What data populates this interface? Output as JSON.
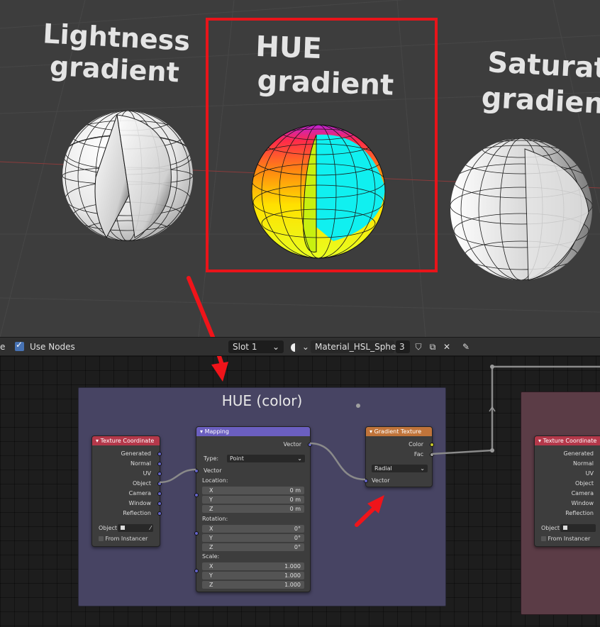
{
  "viewport": {
    "labels": {
      "lightness_line1": "Lightness",
      "lightness_line2": "gradient",
      "hue_line1": "HUE",
      "hue_line2": "gradient",
      "saturation_line1": "Saturat",
      "saturation_line2": "gradient"
    },
    "colors": {
      "highlight_box": "#e8141a",
      "arrow": "#f0141a",
      "background": "#3d3d3d"
    }
  },
  "header": {
    "left_clipped": "e",
    "use_nodes_label": "Use Nodes",
    "use_nodes_checked": true,
    "slot_value": "Slot 1",
    "material_name": "Material_HSL_Sphere",
    "user_count": "3"
  },
  "frames": {
    "hue": {
      "label": "HUE (color)",
      "color": "#474463"
    },
    "right": {
      "label": "",
      "color": "#5b3c46"
    }
  },
  "nodes": {
    "texcoord": {
      "title": "Texture Coordinate",
      "outputs": [
        "Generated",
        "Normal",
        "UV",
        "Object",
        "Camera",
        "Window",
        "Reflection"
      ],
      "object_label": "Object",
      "from_instancer": "From Instancer"
    },
    "texcoord2": {
      "title": "Texture Coordinate",
      "outputs": [
        "Generated",
        "Normal",
        "UV",
        "Object",
        "Camera",
        "Window",
        "Reflection"
      ],
      "object_label": "Object",
      "from_instancer": "From Instancer"
    },
    "mapping": {
      "title": "Mapping",
      "output": "Vector",
      "type_label": "Type:",
      "type_value": "Point",
      "vector_input": "Vector",
      "location_label": "Location:",
      "location": [
        {
          "axis": "X",
          "value": "0 m"
        },
        {
          "axis": "Y",
          "value": "0 m"
        },
        {
          "axis": "Z",
          "value": "0 m"
        }
      ],
      "rotation_label": "Rotation:",
      "rotation": [
        {
          "axis": "X",
          "value": "0°"
        },
        {
          "axis": "Y",
          "value": "0°"
        },
        {
          "axis": "Z",
          "value": "0°"
        }
      ],
      "scale_label": "Scale:",
      "scale": [
        {
          "axis": "X",
          "value": "1.000"
        },
        {
          "axis": "Y",
          "value": "1.000"
        },
        {
          "axis": "Z",
          "value": "1.000"
        }
      ]
    },
    "gradient": {
      "title": "Gradient Texture",
      "out_color": "Color",
      "out_fac": "Fac",
      "type_value": "Radial",
      "vector_input": "Vector"
    }
  }
}
